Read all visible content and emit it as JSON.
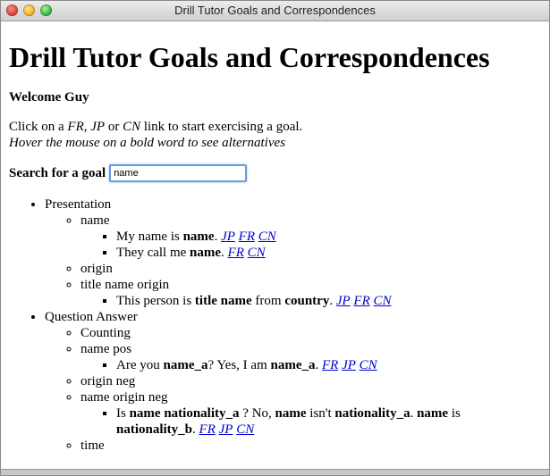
{
  "window": {
    "title": "Drill Tutor Goals and Correspondences"
  },
  "page": {
    "heading": "Drill Tutor Goals and Correspondences",
    "welcome": "Welcome Guy",
    "instr": {
      "p1": "Click on a ",
      "fr": "FR",
      "p2": ", ",
      "jp": "JP",
      "p3": " or ",
      "cn": "CN",
      "p4": " link to start exercising a goal.",
      "hover": "Hover the mouse on a bold word to see alternatives"
    },
    "search": {
      "label": "Search for a goal",
      "value": "name"
    }
  },
  "tree": {
    "presentation": {
      "label": "Presentation",
      "name": {
        "label": "name",
        "s1": {
          "t1": "My name is ",
          "b1": "name",
          "t2": ". ",
          "l1": "JP",
          "l2": "FR",
          "l3": "CN"
        },
        "s2": {
          "t1": "They call me ",
          "b1": "name",
          "t2": ". ",
          "l1": "FR",
          "l2": "CN"
        }
      },
      "origin": {
        "label": "origin"
      },
      "title_name_origin": {
        "label": "title name origin",
        "s1": {
          "t1": "This person is ",
          "b1": "title name",
          "t2": " from ",
          "b2": "country",
          "t3": ". ",
          "l1": "JP",
          "l2": "FR",
          "l3": "CN"
        }
      }
    },
    "qa": {
      "label": "Question Answer",
      "counting": {
        "label": "Counting"
      },
      "name_pos": {
        "label": "name pos",
        "s1": {
          "t1": "Are you ",
          "b1": "name_a",
          "t2": "? Yes, I am ",
          "b2": "name_a",
          "t3": ". ",
          "l1": "FR",
          "l2": "JP",
          "l3": "CN"
        }
      },
      "origin_neg": {
        "label": "origin neg"
      },
      "name_origin_neg": {
        "label": "name origin neg",
        "s1": {
          "t1": "Is ",
          "b1": "name nationality_a",
          "t2": " ? No, ",
          "b2": "name",
          "t3": " isn't ",
          "b3": "nationality_a",
          "t4": ". ",
          "b4": "name",
          "t5": " is ",
          "b5": "nationality_b",
          "t6": ". ",
          "l1": "FR",
          "l2": "JP",
          "l3": "CN"
        }
      },
      "time": {
        "label": "time"
      }
    }
  },
  "colors": {
    "link": "#0000cc",
    "focus": "#6a9be0"
  }
}
